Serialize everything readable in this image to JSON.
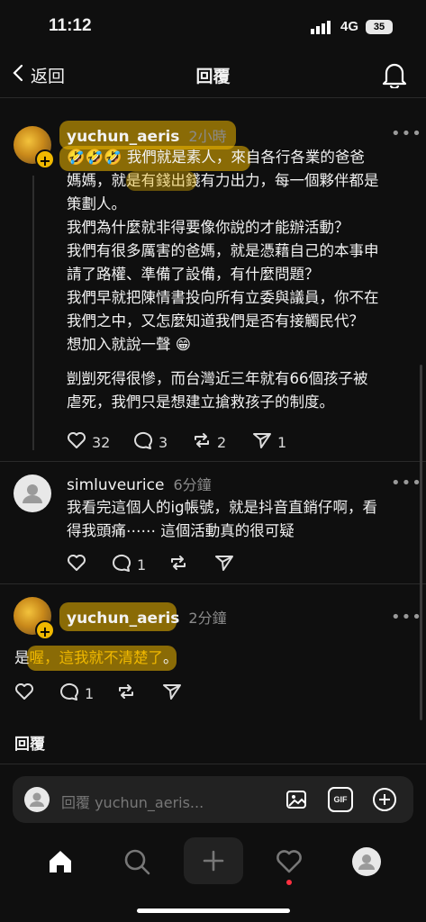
{
  "status": {
    "time": "11:12",
    "network": "4G",
    "battery": "35"
  },
  "header": {
    "back_label": "返回",
    "title": "回覆"
  },
  "posts": [
    {
      "username": "yuchun_aeris",
      "time": "2小時",
      "emoji": "🤣🤣🤣",
      "lines": [
        "我們就是素人，來自各行各業的爸爸",
        "媽媽，就是有錢出錢有力出力，每一個夥伴都是",
        "策劃人。",
        "我們為什麼就非得要像你說的才能辦活動？",
        "我們有很多厲害的爸媽，就是憑藉自己的本事申",
        "請了路權、準備了設備，有什麼問題？",
        "我們早就把陳情書投向所有立委與議員，你不在",
        "我們之中，又怎麼知道我們是否有接觸民代？",
        "想加入就說一聲 😁",
        "剴剴死得很慘，而台灣近三年就有66個孩子被",
        "虐死，我們只是想建立搶救孩子的制度。"
      ],
      "likes": "32",
      "comments": "3",
      "reposts": "2",
      "shares": "1"
    },
    {
      "username": "simluveurice",
      "time": "6分鐘",
      "lines": [
        "我看完這個人的ig帳號，就是抖音直銷仔啊，看",
        "得我頭痛⋯⋯ 這個活動真的很可疑"
      ],
      "comments": "1"
    },
    {
      "username": "yuchun_aeris",
      "time": "2分鐘",
      "text_prefix": "是",
      "text_highlight": "喔，這我就不清楚了",
      "text_suffix": "。",
      "comments": "1"
    }
  ],
  "reply_section_label": "回覆",
  "compose": {
    "placeholder": "回覆 yuchun_aeris...",
    "gif_label": "GIF"
  },
  "colors": {
    "accent": "#f0b800",
    "background": "#0f0f0f",
    "notification_dot": "#ff3040"
  }
}
